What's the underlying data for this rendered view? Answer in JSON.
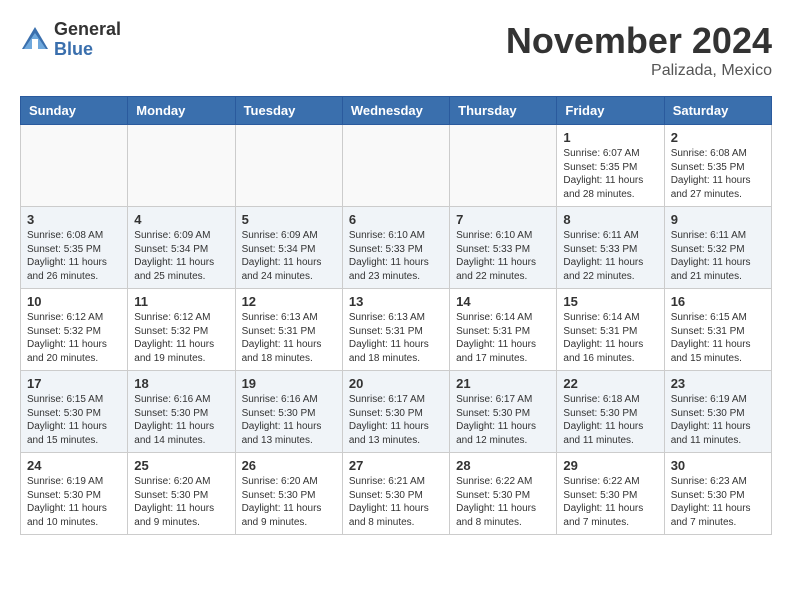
{
  "header": {
    "logo_general": "General",
    "logo_blue": "Blue",
    "month": "November 2024",
    "location": "Palizada, Mexico"
  },
  "weekdays": [
    "Sunday",
    "Monday",
    "Tuesday",
    "Wednesday",
    "Thursday",
    "Friday",
    "Saturday"
  ],
  "weeks": [
    [
      {
        "day": "",
        "info": ""
      },
      {
        "day": "",
        "info": ""
      },
      {
        "day": "",
        "info": ""
      },
      {
        "day": "",
        "info": ""
      },
      {
        "day": "",
        "info": ""
      },
      {
        "day": "1",
        "info": "Sunrise: 6:07 AM\nSunset: 5:35 PM\nDaylight: 11 hours\nand 28 minutes."
      },
      {
        "day": "2",
        "info": "Sunrise: 6:08 AM\nSunset: 5:35 PM\nDaylight: 11 hours\nand 27 minutes."
      }
    ],
    [
      {
        "day": "3",
        "info": "Sunrise: 6:08 AM\nSunset: 5:35 PM\nDaylight: 11 hours\nand 26 minutes."
      },
      {
        "day": "4",
        "info": "Sunrise: 6:09 AM\nSunset: 5:34 PM\nDaylight: 11 hours\nand 25 minutes."
      },
      {
        "day": "5",
        "info": "Sunrise: 6:09 AM\nSunset: 5:34 PM\nDaylight: 11 hours\nand 24 minutes."
      },
      {
        "day": "6",
        "info": "Sunrise: 6:10 AM\nSunset: 5:33 PM\nDaylight: 11 hours\nand 23 minutes."
      },
      {
        "day": "7",
        "info": "Sunrise: 6:10 AM\nSunset: 5:33 PM\nDaylight: 11 hours\nand 22 minutes."
      },
      {
        "day": "8",
        "info": "Sunrise: 6:11 AM\nSunset: 5:33 PM\nDaylight: 11 hours\nand 22 minutes."
      },
      {
        "day": "9",
        "info": "Sunrise: 6:11 AM\nSunset: 5:32 PM\nDaylight: 11 hours\nand 21 minutes."
      }
    ],
    [
      {
        "day": "10",
        "info": "Sunrise: 6:12 AM\nSunset: 5:32 PM\nDaylight: 11 hours\nand 20 minutes."
      },
      {
        "day": "11",
        "info": "Sunrise: 6:12 AM\nSunset: 5:32 PM\nDaylight: 11 hours\nand 19 minutes."
      },
      {
        "day": "12",
        "info": "Sunrise: 6:13 AM\nSunset: 5:31 PM\nDaylight: 11 hours\nand 18 minutes."
      },
      {
        "day": "13",
        "info": "Sunrise: 6:13 AM\nSunset: 5:31 PM\nDaylight: 11 hours\nand 18 minutes."
      },
      {
        "day": "14",
        "info": "Sunrise: 6:14 AM\nSunset: 5:31 PM\nDaylight: 11 hours\nand 17 minutes."
      },
      {
        "day": "15",
        "info": "Sunrise: 6:14 AM\nSunset: 5:31 PM\nDaylight: 11 hours\nand 16 minutes."
      },
      {
        "day": "16",
        "info": "Sunrise: 6:15 AM\nSunset: 5:31 PM\nDaylight: 11 hours\nand 15 minutes."
      }
    ],
    [
      {
        "day": "17",
        "info": "Sunrise: 6:15 AM\nSunset: 5:30 PM\nDaylight: 11 hours\nand 15 minutes."
      },
      {
        "day": "18",
        "info": "Sunrise: 6:16 AM\nSunset: 5:30 PM\nDaylight: 11 hours\nand 14 minutes."
      },
      {
        "day": "19",
        "info": "Sunrise: 6:16 AM\nSunset: 5:30 PM\nDaylight: 11 hours\nand 13 minutes."
      },
      {
        "day": "20",
        "info": "Sunrise: 6:17 AM\nSunset: 5:30 PM\nDaylight: 11 hours\nand 13 minutes."
      },
      {
        "day": "21",
        "info": "Sunrise: 6:17 AM\nSunset: 5:30 PM\nDaylight: 11 hours\nand 12 minutes."
      },
      {
        "day": "22",
        "info": "Sunrise: 6:18 AM\nSunset: 5:30 PM\nDaylight: 11 hours\nand 11 minutes."
      },
      {
        "day": "23",
        "info": "Sunrise: 6:19 AM\nSunset: 5:30 PM\nDaylight: 11 hours\nand 11 minutes."
      }
    ],
    [
      {
        "day": "24",
        "info": "Sunrise: 6:19 AM\nSunset: 5:30 PM\nDaylight: 11 hours\nand 10 minutes."
      },
      {
        "day": "25",
        "info": "Sunrise: 6:20 AM\nSunset: 5:30 PM\nDaylight: 11 hours\nand 9 minutes."
      },
      {
        "day": "26",
        "info": "Sunrise: 6:20 AM\nSunset: 5:30 PM\nDaylight: 11 hours\nand 9 minutes."
      },
      {
        "day": "27",
        "info": "Sunrise: 6:21 AM\nSunset: 5:30 PM\nDaylight: 11 hours\nand 8 minutes."
      },
      {
        "day": "28",
        "info": "Sunrise: 6:22 AM\nSunset: 5:30 PM\nDaylight: 11 hours\nand 8 minutes."
      },
      {
        "day": "29",
        "info": "Sunrise: 6:22 AM\nSunset: 5:30 PM\nDaylight: 11 hours\nand 7 minutes."
      },
      {
        "day": "30",
        "info": "Sunrise: 6:23 AM\nSunset: 5:30 PM\nDaylight: 11 hours\nand 7 minutes."
      }
    ]
  ]
}
